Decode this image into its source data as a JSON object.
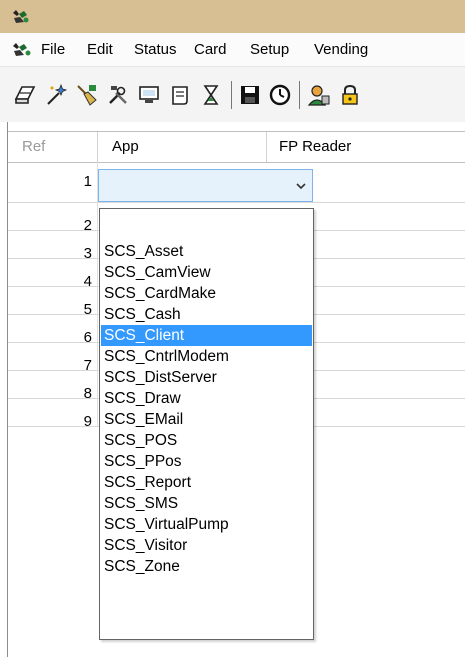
{
  "menu": {
    "items": [
      "File",
      "Edit",
      "Status",
      "Card",
      "Setup",
      "Vending"
    ]
  },
  "toolbar": {
    "icons": [
      "scanner-icon",
      "wand-icon",
      "broom-icon",
      "tools-icon",
      "monitor-icon",
      "scroll-icon",
      "hourglass-icon",
      "save-icon",
      "clock-icon",
      "user-icon",
      "lock-icon"
    ]
  },
  "grid": {
    "headers": {
      "ref": "Ref",
      "app": "App",
      "fp_reader": "FP Reader"
    },
    "rows": [
      "1",
      "2",
      "3",
      "4",
      "5",
      "6",
      "7",
      "8",
      "9"
    ]
  },
  "combo": {
    "value": ""
  },
  "dropdown": {
    "selected": "SCS_Client",
    "options": [
      "",
      "SCS_Asset",
      "SCS_CamView",
      "SCS_CardMake",
      "SCS_Cash",
      "SCS_Client",
      "SCS_CntrlModem",
      "SCS_DistServer",
      "SCS_Draw",
      "SCS_EMail",
      "SCS_POS",
      "SCS_PPos",
      "SCS_Report",
      "SCS_SMS",
      "SCS_VirtualPump",
      "SCS_Visitor",
      "SCS_Zone"
    ]
  },
  "colors": {
    "titlebar": "#d8bf93",
    "selection": "#3399ff",
    "combo_bg": "#e5f1fb"
  }
}
